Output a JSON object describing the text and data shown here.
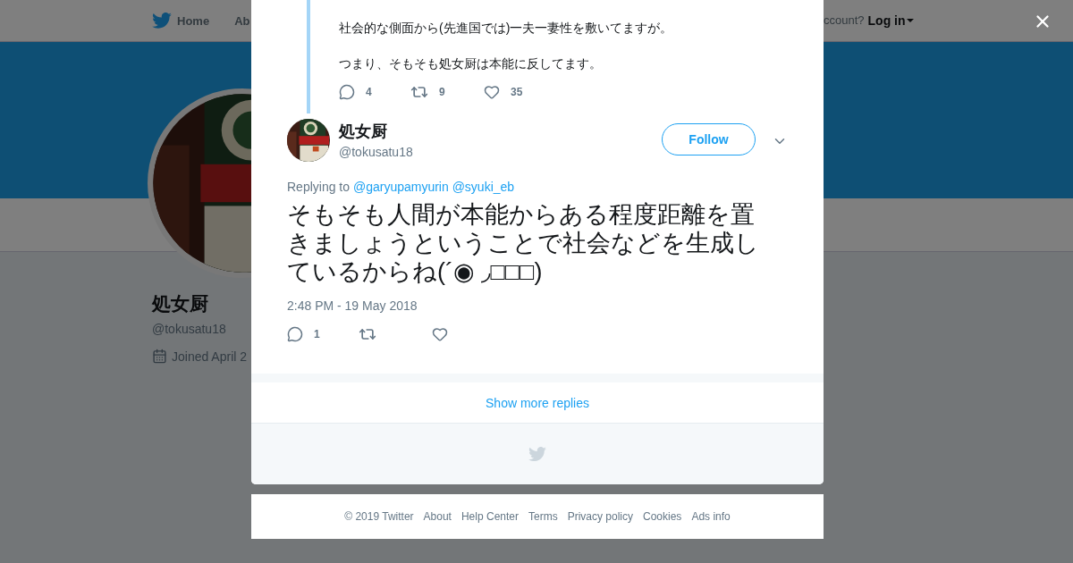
{
  "background_page": {
    "nav": [
      {
        "label": "Home"
      },
      {
        "label": "Ab"
      }
    ],
    "login_prompt": "ccount?",
    "login_link": "Log in",
    "profile": {
      "name": "処女厨",
      "handle": "@tokusatu18",
      "joined": "Joined April 2"
    }
  },
  "modal": {
    "parent_tweet": {
      "paragraphs": [
        "社会的な側面から(先進国では)一夫一妻性を敷いてますが。",
        "つまり、そもそも処女厨は本能に反してます。"
      ],
      "replies": "4",
      "retweets": "9",
      "likes": "35"
    },
    "tweet": {
      "name": "処女厨",
      "handle": "@tokusatu18",
      "follow": "Follow",
      "replying_label": "Replying to",
      "replying_to": [
        "@garyupamyurin",
        "@syuki_eb"
      ],
      "text": "そもそも人間が本能からある程度距離を置きましょうということで社会などを生成しているからね(´◉ ◞□□□)",
      "time": "2:48 PM - 19 May 2018",
      "replies": "1"
    },
    "show_more": "Show more replies"
  },
  "footer": [
    "© 2019 Twitter",
    "About",
    "Help Center",
    "Terms",
    "Privacy policy",
    "Cookies",
    "Ads info"
  ]
}
